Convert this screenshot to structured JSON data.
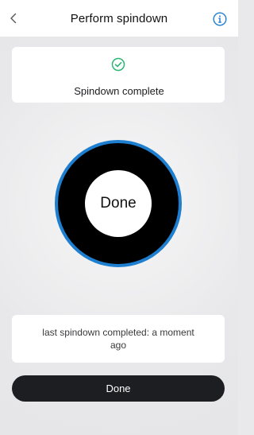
{
  "header": {
    "title": "Perform spindown",
    "back_icon": "chevron-left-icon",
    "info_icon": "info-icon"
  },
  "status": {
    "icon": "check-circle-icon",
    "text": "Spindown complete"
  },
  "progress": {
    "label": "Done",
    "fraction": 1.0
  },
  "info_card": {
    "text": "last spindown completed: a moment ago"
  },
  "actions": {
    "done_label": "Done"
  },
  "colors": {
    "accent": "#1e7fd0",
    "success": "#2bb673",
    "button_bg": "#1c1e21"
  }
}
